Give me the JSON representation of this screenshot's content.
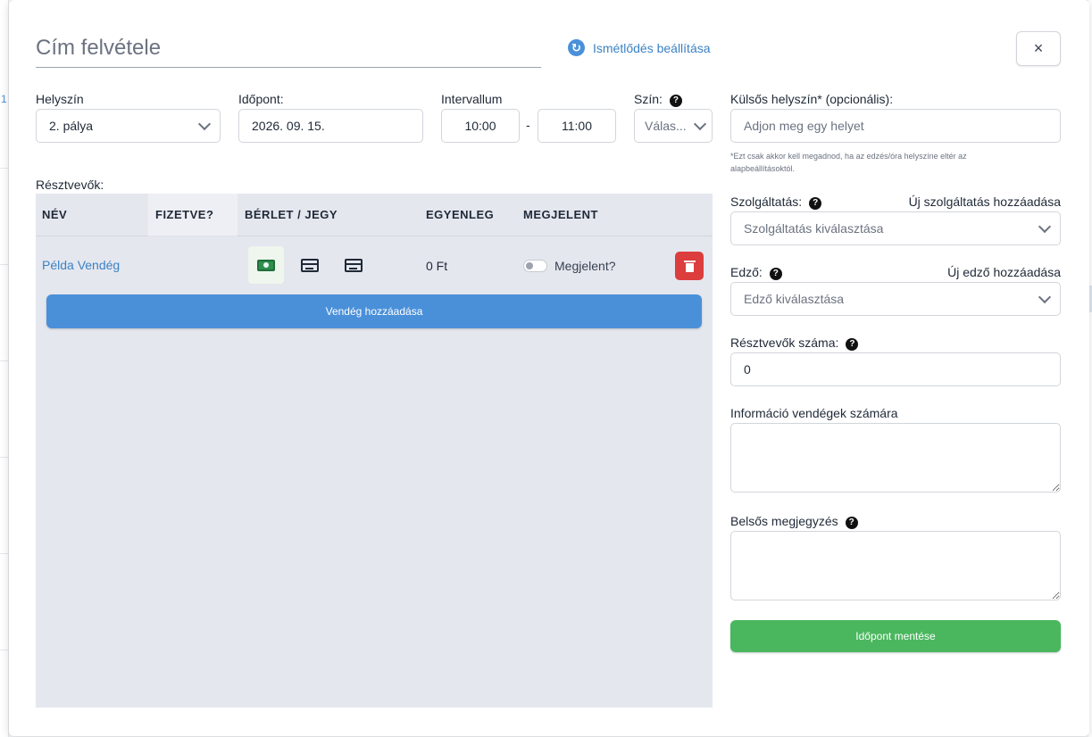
{
  "background": {
    "row_number": "1"
  },
  "header": {
    "title_placeholder": "Cím felvétele",
    "repeat_link": "Ismétlődés beállítása",
    "close_label": "×"
  },
  "form": {
    "location": {
      "label": "Helyszín",
      "value": "2. pálya"
    },
    "date": {
      "label": "Időpont:",
      "value": "2026. 09. 15."
    },
    "interval": {
      "label": "Intervallum",
      "start": "10:00",
      "separator": "-",
      "end": "11:00"
    },
    "color": {
      "label": "Szín:",
      "value": "Válas..."
    },
    "external_location": {
      "label": "Külsős helyszín* (opcionális):",
      "placeholder": "Adjon meg egy helyet",
      "note": "*Ezt csak akkor kell megadnod, ha az edzés/óra helyszíne eltér az alapbeállításoktól."
    },
    "service": {
      "label": "Szolgáltatás:",
      "add_link": "Új szolgáltatás hozzáadása",
      "placeholder": "Szolgáltatás kiválasztása"
    },
    "trainer": {
      "label": "Edző:",
      "add_link": "Új edző hozzáadása",
      "placeholder": "Edző kiválasztása"
    },
    "participant_count": {
      "label": "Résztvevők száma:",
      "value": "0"
    },
    "guest_info": {
      "label": "Információ vendégek számára",
      "value": ""
    },
    "internal_note": {
      "label": "Belsős megjegyzés",
      "value": ""
    },
    "save_button": "Időpont mentése"
  },
  "participants": {
    "label": "Résztvevők:",
    "columns": [
      "NÉV",
      "FIZETVE?",
      "BÉRLET / JEGY",
      "EGYENLEG",
      "MEGJELENT"
    ],
    "rows": [
      {
        "name": "Példa Vendég",
        "balance": "0 Ft",
        "attended_label": "Megjelent?",
        "attended": false,
        "payment_selected": "cash"
      }
    ],
    "add_button": "Vendég hozzáadása"
  },
  "icons": {
    "repeat": "refresh-icon",
    "help": "question-circle-icon",
    "chevron": "chevron-down-icon",
    "cash": "cash-icon",
    "card": "credit-card-icon",
    "trash": "trash-icon"
  },
  "colors": {
    "primary": "#4a90d9",
    "danger": "#dc3d3d",
    "success": "#4ab75e",
    "participants_bg": "#e5e7ef"
  }
}
